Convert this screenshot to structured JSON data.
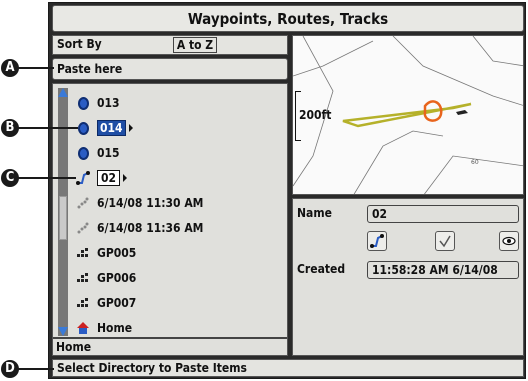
{
  "window": {
    "title": "Waypoints, Routes, Tracks"
  },
  "sort": {
    "label": "Sort By",
    "value": "A to Z"
  },
  "paste": {
    "text": "Paste here"
  },
  "list": {
    "items": [
      {
        "label": "013",
        "icon": "waypoint-icon",
        "state": "normal"
      },
      {
        "label": "014",
        "icon": "waypoint-icon",
        "state": "selected"
      },
      {
        "label": "015",
        "icon": "waypoint-icon",
        "state": "normal"
      },
      {
        "label": "02",
        "icon": "route-icon",
        "state": "boxed"
      },
      {
        "label": "6/14/08 11:30 AM",
        "icon": "track-icon",
        "state": "normal"
      },
      {
        "label": "6/14/08 11:36 AM",
        "icon": "track-icon",
        "state": "normal"
      },
      {
        "label": "GP005",
        "icon": "group-icon",
        "state": "normal"
      },
      {
        "label": "GP006",
        "icon": "group-icon",
        "state": "normal"
      },
      {
        "label": "GP007",
        "icon": "group-icon",
        "state": "normal"
      },
      {
        "label": "Home",
        "icon": "home-icon",
        "state": "normal"
      }
    ],
    "footer": "Home"
  },
  "map": {
    "scale": "200ft",
    "depth_label": "60"
  },
  "details": {
    "name_label": "Name",
    "name_value": "02",
    "created_label": "Created",
    "created_value": "11:58:28 AM 6/14/08",
    "buttons": [
      "route-icon",
      "checkmark-icon",
      "eye-icon"
    ]
  },
  "status": {
    "text": "Select Directory to Paste Items"
  },
  "callouts": [
    "A",
    "B",
    "C",
    "D"
  ],
  "colors": {
    "selection": "#1f4ea5",
    "scroll_arrow": "#3a7ad8",
    "route_line": "#b5b12a",
    "track_line": "#e8641c"
  }
}
